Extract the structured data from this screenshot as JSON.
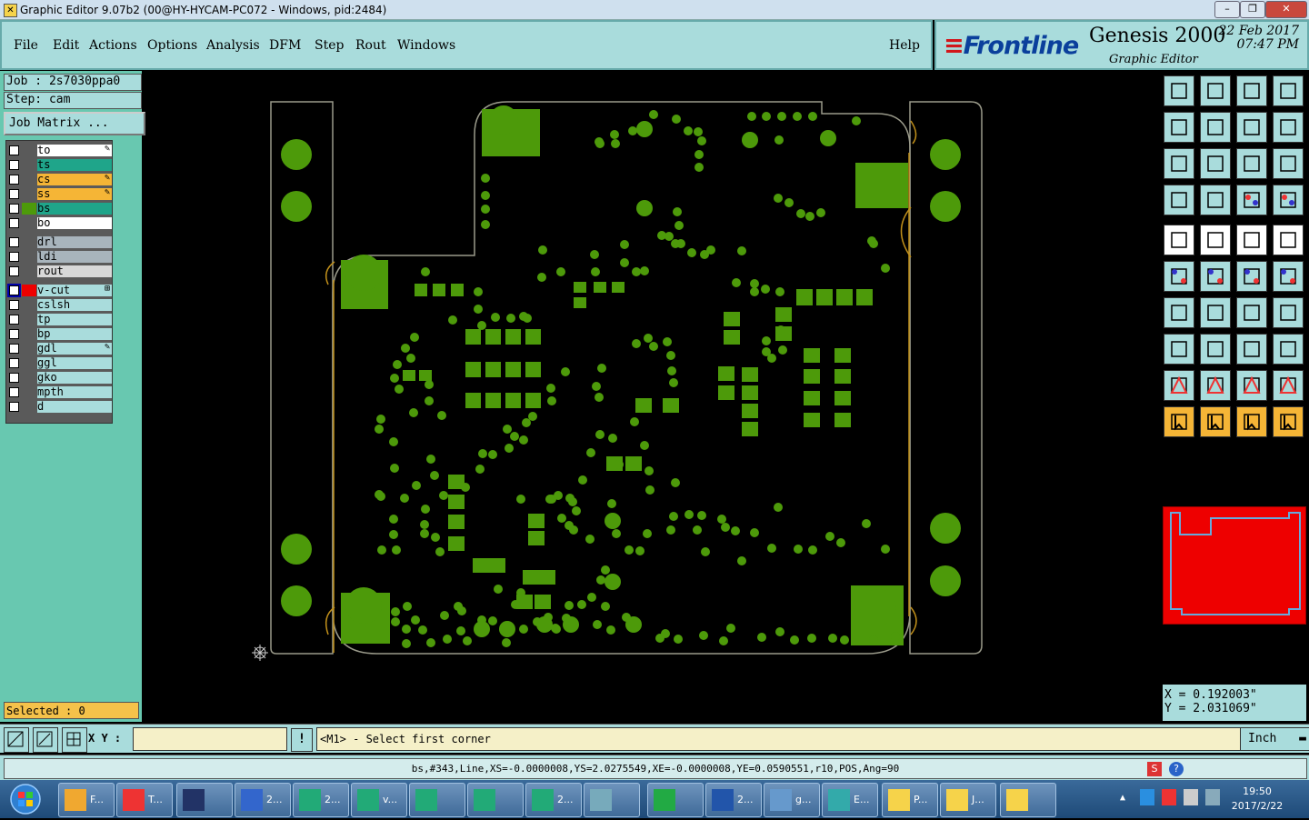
{
  "window": {
    "title": "Graphic Editor 9.07b2 (00@HY-HYCAM-PC072 - Windows, pid:2484)",
    "controls": [
      "–",
      "❐",
      "✕"
    ]
  },
  "menu": [
    "File",
    "Edit",
    "Actions",
    "Options",
    "Analysis",
    "DFM",
    "Step",
    "Rout",
    "Windows"
  ],
  "help": "Help",
  "brand": {
    "logo": "Frontline",
    "product": "Genesis 2000",
    "subtitle": "Graphic Editor",
    "date": "22 Feb 2017",
    "time": "07:47 PM"
  },
  "job": {
    "label": "Job : 2s7030ppa0",
    "step": "Step: cam",
    "matrix_button": "Job Matrix ..."
  },
  "layers": [
    {
      "name": "to",
      "color": "#ffffff",
      "mark": "✎"
    },
    {
      "name": "ts",
      "color": "#1fa58a",
      "mark": ""
    },
    {
      "name": "cs",
      "color": "#f5b536",
      "mark": "✎"
    },
    {
      "name": "ss",
      "color": "#f5b536",
      "mark": "✎"
    },
    {
      "name": "bs",
      "color": "#1fa58a",
      "mark": "",
      "active": true
    },
    {
      "name": "bo",
      "color": "#ffffff",
      "mark": ""
    },
    {
      "name": "drl",
      "color": "#a8b4bc",
      "mark": ""
    },
    {
      "name": "ldi",
      "color": "#a8b4bc",
      "mark": ""
    },
    {
      "name": "rout",
      "color": "#d8d8d8",
      "mark": ""
    },
    {
      "name": "v-cut",
      "color": "#a9dcdc",
      "mark": "⊞"
    },
    {
      "name": "cslsh",
      "color": "#a9dcdc",
      "mark": ""
    },
    {
      "name": "tp",
      "color": "#a9dcdc",
      "mark": ""
    },
    {
      "name": "bp",
      "color": "#a9dcdc",
      "mark": ""
    },
    {
      "name": "gdl",
      "color": "#a9dcdc",
      "mark": "✎"
    },
    {
      "name": "ggl",
      "color": "#a9dcdc",
      "mark": ""
    },
    {
      "name": "gko",
      "color": "#a9dcdc",
      "mark": ""
    },
    {
      "name": "mpth",
      "color": "#a9dcdc",
      "mark": ""
    },
    {
      "name": "d",
      "color": "#a9dcdc",
      "mark": ""
    }
  ],
  "selected": "Selected : 0",
  "coords": {
    "x": "X = 0.192003\"",
    "y": "Y = 2.031069\""
  },
  "command": {
    "xy_label": "X Y :",
    "xy_value": "",
    "prompt": "<M1> - Select first corner",
    "unit": "Inch"
  },
  "status": "bs,#343,Line,XS=-0.0000008,YS=2.0275549,XE=-0.0000008,YE=0.0590551,r10,POS,Ang=90",
  "taskbar": {
    "items": [
      "F...",
      "T...",
      "",
      "2...",
      "2...",
      "v...",
      "",
      "",
      "2...",
      "",
      "",
      "2...",
      "g...",
      "E...",
      "P...",
      "J...",
      ""
    ],
    "clock_time": "19:50",
    "clock_date": "2017/2/22"
  },
  "colors": {
    "pcb_copper": "#4d9a0a",
    "outline": "#9a9a8a",
    "panel": "#a9dcdc",
    "accent": "#68c8b0"
  }
}
